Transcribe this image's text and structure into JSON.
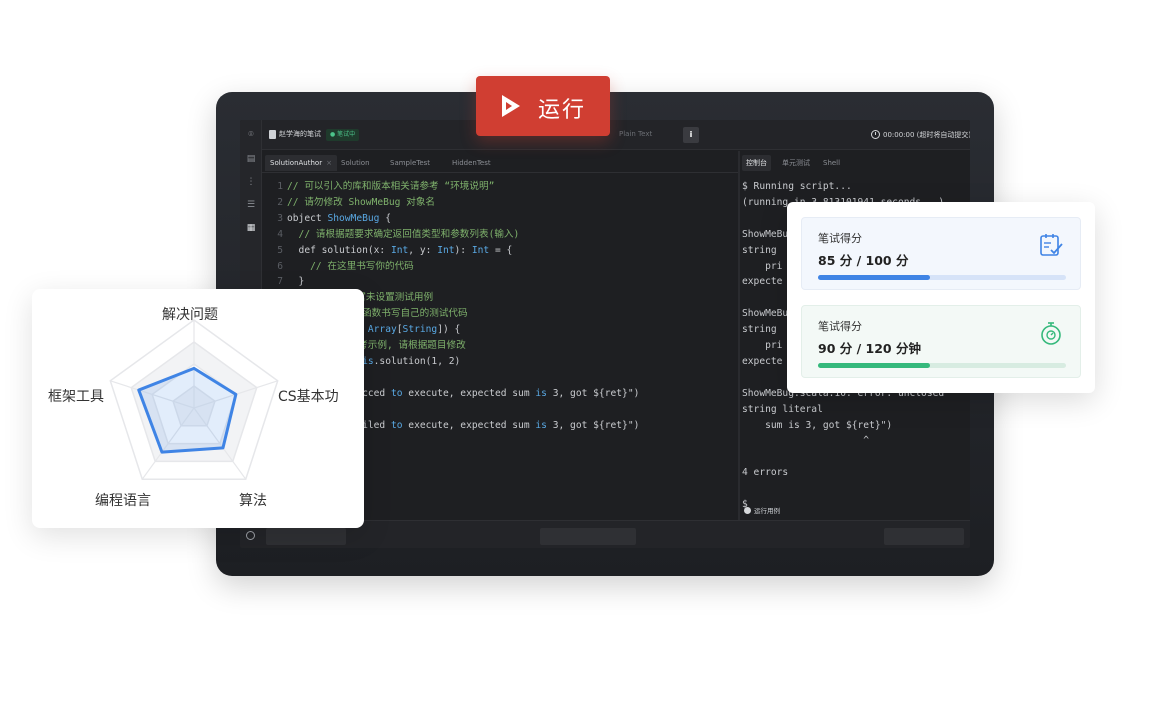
{
  "run_button": {
    "label": "运行"
  },
  "topbar": {
    "title": "赵学海的笔试",
    "status": "● 笔试中",
    "language": "Plain Text",
    "info": "i",
    "timer": "00:00:00 (超时将自动提交)"
  },
  "editor": {
    "tabs": [
      {
        "label": "SolutionAuthor",
        "close": "×"
      },
      {
        "label": "Solution"
      },
      {
        "label": "SampleTest"
      },
      {
        "label": "HiddenTest"
      }
    ],
    "lines": [
      {
        "n": "1",
        "segs": [
          {
            "t": "// 可以引入的库和版本相关请参考 “环境说明”",
            "c": "c-comment"
          }
        ]
      },
      {
        "n": "2",
        "segs": [
          {
            "t": "// 请勿修改 ShowMeBug 对象名",
            "c": "c-comment"
          }
        ]
      },
      {
        "n": "3",
        "segs": [
          {
            "t": "object ",
            "c": "c-kw"
          },
          {
            "t": "ShowMeBug",
            "c": "c-type"
          },
          {
            "t": " {",
            "c": "c-kw"
          }
        ]
      },
      {
        "n": "4",
        "segs": [
          {
            "t": "  // 请根据题要求确定返回值类型和参数列表(输入)",
            "c": "c-comment"
          }
        ]
      },
      {
        "n": "5",
        "segs": [
          {
            "t": "  def solution(x: ",
            "c": "c-kw"
          },
          {
            "t": "Int",
            "c": "c-type"
          },
          {
            "t": ", y: ",
            "c": "c-kw"
          },
          {
            "t": "Int",
            "c": "c-type"
          },
          {
            "t": "): ",
            "c": "c-kw"
          },
          {
            "t": "Int",
            "c": "c-type"
          },
          {
            "t": " = {",
            "c": "c-kw"
          }
        ]
      },
      {
        "n": "6",
        "segs": [
          {
            "t": "    // 在这里书写你的代码",
            "c": "c-comment"
          }
        ]
      },
      {
        "n": "7",
        "segs": [
          {
            "t": "  }",
            "c": "c-kw"
          }
        ]
      },
      {
        "n": "",
        "segs": [
          {
            "t": "            官未设置测试用例",
            "c": "c-comment"
          }
        ]
      },
      {
        "n": "",
        "segs": [
          {
            "t": "           n 函数书写自己的测试代码",
            "c": "c-comment"
          }
        ]
      },
      {
        "n": "",
        "segs": [
          {
            "t": "         rgs: ",
            "c": "c-kw"
          },
          {
            "t": "Array",
            "c": "c-type"
          },
          {
            "t": "[",
            "c": "c-kw"
          },
          {
            "t": "String",
            "c": "c-type"
          },
          {
            "t": "]) {",
            "c": "c-kw"
          }
        ]
      },
      {
        "n": "",
        "segs": [
          {
            "t": "         码参考示例, 请根据题目修改",
            "c": "c-comment"
          }
        ]
      },
      {
        "n": "",
        "segs": [
          {
            "t": "         = ",
            "c": "c-kw"
          },
          {
            "t": "this",
            "c": "c-type"
          },
          {
            "t": ".solution(1, 2)",
            "c": "c-kw"
          }
        ]
      },
      {
        "n": "",
        "segs": [
          {
            "t": "         = 3)",
            "c": "c-kw"
          }
        ]
      },
      {
        "n": "",
        "segs": [
          {
            "t": "         f\"succed ",
            "c": "c-str"
          },
          {
            "t": "to",
            "c": "c-type"
          },
          {
            "t": " execute, expected sum ",
            "c": "c-str"
          },
          {
            "t": "is",
            "c": "c-type"
          },
          {
            "t": " 3, got ${ret}\")",
            "c": "c-str"
          }
        ]
      },
      {
        "n": "",
        "segs": [
          {
            "t": "",
            "c": "c-kw"
          }
        ]
      },
      {
        "n": "",
        "segs": [
          {
            "t": "         f\"failed ",
            "c": "c-str"
          },
          {
            "t": "to",
            "c": "c-type"
          },
          {
            "t": " execute, expected sum ",
            "c": "c-str"
          },
          {
            "t": "is",
            "c": "c-type"
          },
          {
            "t": " 3, got ${ret}\")",
            "c": "c-str"
          }
        ]
      }
    ]
  },
  "console": {
    "tabs": [
      "控制台",
      "单元测试",
      "Shell"
    ],
    "lines": [
      "$ Running script...",
      "(running in 3.813101941 seconds...)",
      "",
      "ShowMeBu",
      "string",
      "    pri",
      "expecte",
      "",
      "ShowMeBu",
      "string",
      "    pri",
      "expecte",
      "",
      "ShowMeBug.scala:10: error: unclosed",
      "string literal",
      "    sum is 3, got ${ret}\")",
      "                     ^",
      "",
      "4 errors",
      "",
      "$"
    ],
    "run_cases": "运行用例"
  },
  "radar": {
    "axes": [
      "解决问题",
      "CS基本功",
      "算法",
      "编程语言",
      "框架工具"
    ],
    "values": [
      0.45,
      0.5,
      0.56,
      0.62,
      0.66
    ],
    "max": 1,
    "color": "#3f84e5"
  },
  "scores": [
    {
      "title": "笔试得分",
      "value": "85 分 / 100 分",
      "progress": 0.45,
      "color": "#3f84e5"
    },
    {
      "title": "笔试得分",
      "value": "90 分 / 120 分钟",
      "progress": 0.45,
      "color": "#35b97c"
    }
  ]
}
